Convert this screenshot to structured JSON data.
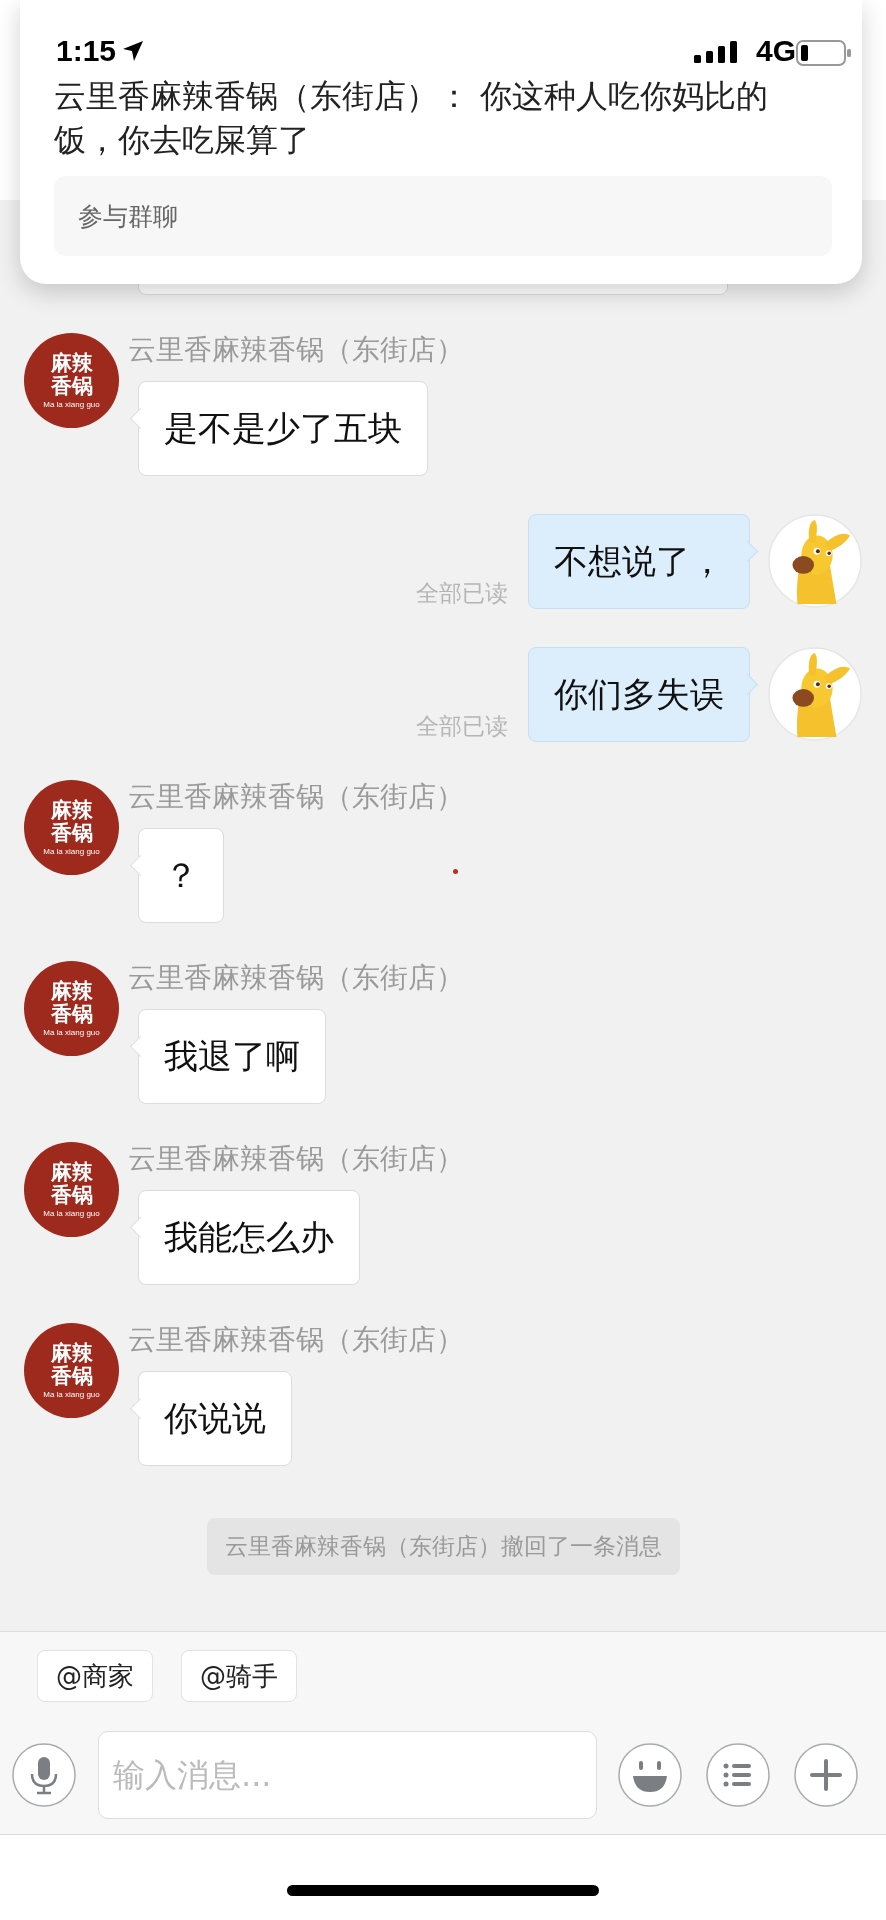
{
  "status_bar": {
    "time": "1:15",
    "network": "4G"
  },
  "notification": {
    "text": "云里香麻辣香锅（东街店）： 你这种人吃你妈比的饭，你去吃屎算了",
    "action": "参与群聊"
  },
  "messages": [
    {
      "kind": "partial"
    },
    {
      "kind": "incoming",
      "sender": "云里香麻辣香锅（东街店）",
      "avatar": {
        "line1": "麻辣",
        "line2": "香锅",
        "caption": "Ma la xiang guo"
      },
      "text": "是不是少了五块"
    },
    {
      "kind": "outgoing",
      "text": "不想说了，",
      "receipt": "全部已读"
    },
    {
      "kind": "outgoing",
      "text": "你们多失误",
      "receipt": "全部已读"
    },
    {
      "kind": "incoming",
      "sender": "云里香麻辣香锅（东街店）",
      "avatar": {
        "line1": "麻辣",
        "line2": "香锅",
        "caption": "Ma la xiang guo"
      },
      "text": "？"
    },
    {
      "kind": "incoming",
      "sender": "云里香麻辣香锅（东街店）",
      "avatar": {
        "line1": "麻辣",
        "line2": "香锅",
        "caption": "Ma la xiang guo"
      },
      "text": "我退了啊"
    },
    {
      "kind": "incoming",
      "sender": "云里香麻辣香锅（东街店）",
      "avatar": {
        "line1": "麻辣",
        "line2": "香锅",
        "caption": "Ma la xiang guo"
      },
      "text": "我能怎么办"
    },
    {
      "kind": "incoming",
      "sender": "云里香麻辣香锅（东街店）",
      "avatar": {
        "line1": "麻辣",
        "line2": "香锅",
        "caption": "Ma la xiang guo"
      },
      "text": "你说说"
    },
    {
      "kind": "system",
      "text": "云里香麻辣香锅（东街店）撤回了一条消息"
    }
  ],
  "quick_replies": [
    "@商家",
    "@骑手"
  ],
  "input": {
    "placeholder": "输入消息..."
  }
}
